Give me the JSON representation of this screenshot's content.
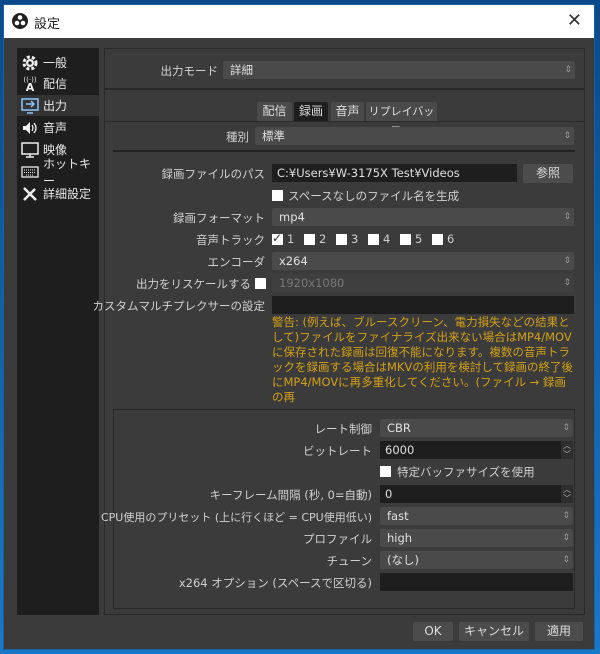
{
  "window": {
    "title": "設定"
  },
  "sidebar": {
    "items": [
      {
        "label": "一般",
        "icon": "gear-icon"
      },
      {
        "label": "配信",
        "icon": "broadcast-icon"
      },
      {
        "label": "出力",
        "icon": "output-icon",
        "selected": true
      },
      {
        "label": "音声",
        "icon": "speaker-icon"
      },
      {
        "label": "映像",
        "icon": "monitor-icon"
      },
      {
        "label": "ホットキー",
        "icon": "keyboard-icon"
      },
      {
        "label": "詳細設定",
        "icon": "tools-icon"
      }
    ]
  },
  "output_mode": {
    "label": "出力モード",
    "value": "詳細"
  },
  "tabs": [
    {
      "label": "配信"
    },
    {
      "label": "録画",
      "selected": true
    },
    {
      "label": "音声"
    },
    {
      "label": "リプレイバッファ"
    }
  ],
  "recording": {
    "type": {
      "label": "種別",
      "value": "標準"
    },
    "path": {
      "label": "録画ファイルのパス",
      "value": "C:¥Users¥W-3175X Test¥Videos",
      "browse": "参照"
    },
    "no_space": {
      "label": "スペースなしのファイル名を生成",
      "checked": false
    },
    "format": {
      "label": "録画フォーマット",
      "value": "mp4"
    },
    "tracks": {
      "label": "音声トラック",
      "items": [
        {
          "n": "1",
          "checked": true
        },
        {
          "n": "2",
          "checked": false
        },
        {
          "n": "3",
          "checked": false
        },
        {
          "n": "4",
          "checked": false
        },
        {
          "n": "5",
          "checked": false
        },
        {
          "n": "6",
          "checked": false
        }
      ]
    },
    "encoder": {
      "label": "エンコーダ",
      "value": "x264"
    },
    "rescale": {
      "label": "出力をリスケールする",
      "checked": false,
      "value": "1920x1080",
      "disabled": true
    },
    "muxer": {
      "label": "カスタムマルチプレクサーの設定",
      "value": ""
    },
    "warning": "警告: (例えば、ブルースクリーン、電力損失などの結果として)ファイルをファイナライズ出来ない場合はMP4/MOVに保存された録画は回復不能になります。複数の音声トラックを録画する場合はMKVの利用を検討して録画の終了後にMP4/MOVに再多重化してください。(ファイル → 録画の再",
    "warning_color": "#d4a017"
  },
  "encoder_settings": {
    "rate_control": {
      "label": "レート制御",
      "value": "CBR"
    },
    "bitrate": {
      "label": "ビットレート",
      "value": "6000"
    },
    "buffer": {
      "label": "特定バッファサイズを使用",
      "checked": false
    },
    "keyframe": {
      "label": "キーフレーム間隔 (秒, 0=自動)",
      "value": "0"
    },
    "preset": {
      "label": "CPU使用のプリセット (上に行くほど = CPU使用低い)",
      "value": "fast"
    },
    "profile": {
      "label": "プロファイル",
      "value": "high"
    },
    "tune": {
      "label": "チューン",
      "value": "(なし)"
    },
    "options": {
      "label": "x264 オプション (スペースで区切る)",
      "value": ""
    }
  },
  "buttons": {
    "ok": "OK",
    "cancel": "キャンセル",
    "apply": "適用"
  }
}
